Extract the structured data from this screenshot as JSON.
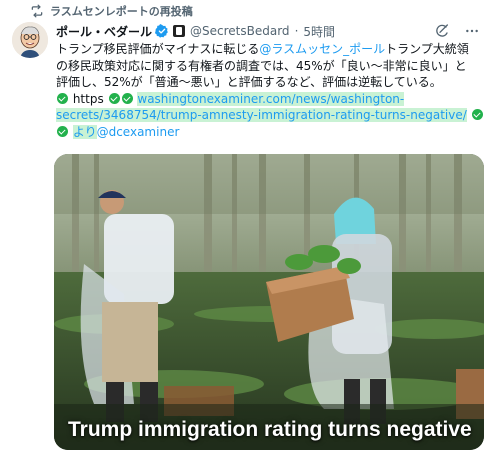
{
  "repost": {
    "label": "ラスムセンレポートの再投稿",
    "icon": "repost-icon"
  },
  "author": {
    "display_name": "ポール・ベダール",
    "handle": "@SecretsBedard",
    "separator": "·",
    "time": "5時間",
    "avatar_icon": "avatar-caricature"
  },
  "tweet": {
    "line1_pre": "トランプ移民評価がマイナスに転じる",
    "line1_mention": "@ラスムッセン_ポール",
    "line1_post": "トランプ大統領",
    "line2": "の移民政策対応に関する有権者の調査では、45%が「良い～非常に良い」と",
    "line3": "評価し、52%が「普通～悪い」と評価するなど、評価は逆転している。",
    "line4_pre": "https",
    "line4_link": "washingtonexaminer.com/news/washington-",
    "line5_link": "secrets/3468754/trump-amnesty-immigration-rating-turns-negative/",
    "line6_link": "より",
    "line6_mention": "@dcexaminer"
  },
  "media": {
    "caption": "Trump immigration rating turns negative",
    "description_icon": "farmworkers-photo"
  },
  "colors": {
    "accent": "#1d9bf0",
    "link_highlight": "#c9f2d4",
    "check_green": "#22b14c",
    "muted": "#536471"
  }
}
